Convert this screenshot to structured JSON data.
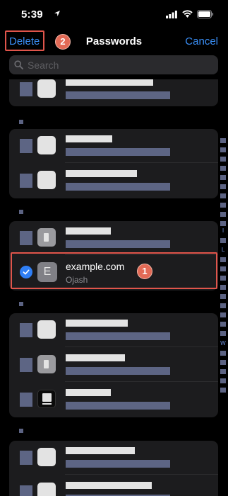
{
  "status_bar": {
    "time": "5:39",
    "icons": [
      "location-arrow-icon",
      "cellular-signal-icon",
      "wifi-icon",
      "battery-icon"
    ]
  },
  "nav": {
    "delete_label": "Delete",
    "title": "Passwords",
    "cancel_label": "Cancel"
  },
  "search": {
    "placeholder": "Search"
  },
  "annotations": {
    "marker_1": "1",
    "marker_2": "2"
  },
  "selected_item": {
    "letter": "E",
    "site": "example.com",
    "username": "Ojash",
    "selected": true
  },
  "index_letters": {
    "i": "I",
    "l": "L",
    "w": "W"
  },
  "colors": {
    "accent": "#3a8ff7",
    "annotation": "#e0554b",
    "background": "#000000",
    "cell": "#1c1c1e",
    "redacted": "#5d6584"
  }
}
